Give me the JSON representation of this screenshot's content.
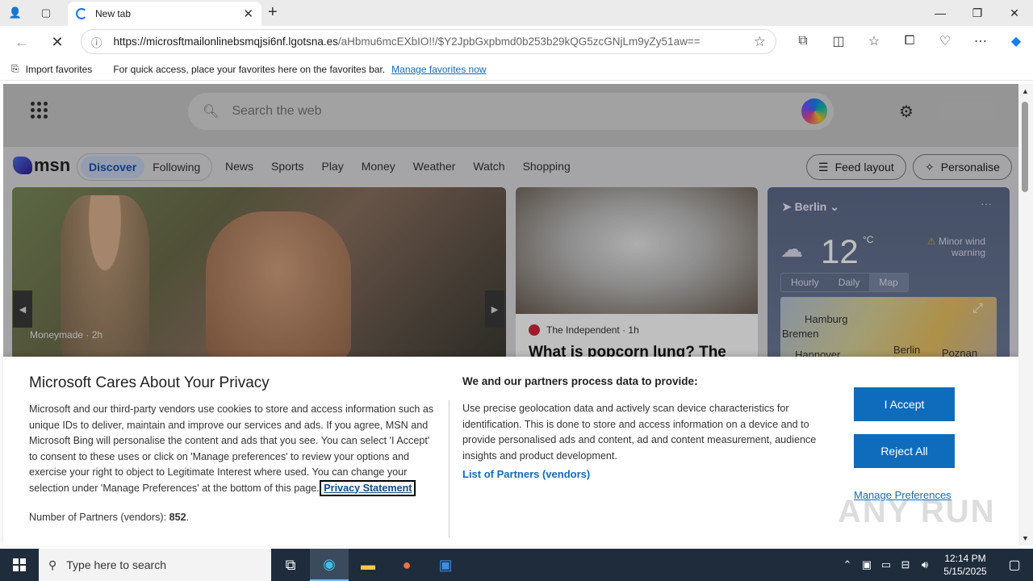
{
  "browser": {
    "tab_title": "New tab",
    "url_host": "https://microsftmailonlinebsmqjsi6nf.lgotsna.es",
    "url_path": "/aHbmu6mcEXbIO!!/$Y2JpbGxpbmd0b253b29kQG5zcGNjLm9yZy51aw==",
    "fav_import": "Import favorites",
    "fav_hint": "For quick access, place your favorites here on the favorites bar.",
    "fav_manage": "Manage favorites now"
  },
  "msn": {
    "search_placeholder": "Search the web",
    "logo_text": "msn",
    "pill": [
      "Discover",
      "Following"
    ],
    "nav": [
      "News",
      "Sports",
      "Play",
      "Money",
      "Weather",
      "Watch",
      "Shopping"
    ],
    "feed_layout": "Feed layout",
    "personalise": "Personalise",
    "hero_source": "Moneymade · 2h",
    "card2_source": "The Independent · 1h",
    "card2_headline": "What is popcorn lung? The",
    "weather": {
      "city": "Berlin",
      "temp": "12",
      "unit": "°C",
      "warning": "Minor wind warning",
      "tabs": [
        "Hourly",
        "Daily",
        "Map"
      ],
      "map_labels": [
        "Hamburg",
        "Bremen",
        "Berlin",
        "Poznan",
        "Hannover"
      ]
    }
  },
  "consent": {
    "title": "Microsoft Cares About Your Privacy",
    "body": "Microsoft and our third-party vendors use cookies to store and access information such as unique IDs to deliver, maintain and improve our services and ads. If you agree, MSN and Microsoft Bing will personalise the content and ads that you see. You can select 'I Accept' to consent to these uses or click on 'Manage preferences' to review your options and exercise your right to object to Legitimate Interest where used.  You can change your selection under 'Manage Preferences' at the bottom of this page.",
    "privacy_link": "Privacy Statement",
    "partners_label": "Number of Partners (vendors):",
    "partners_count": "852",
    "purpose_title": "We and our partners process data to provide:",
    "purpose_body": "Use precise geolocation data and actively scan device characteristics for identification. This is done to store and access information on a device and to provide personalised ads and content, ad and content measurement, audience insights and product development.",
    "partners_link": "List of Partners (vendors)",
    "accept": "I Accept",
    "reject": "Reject All",
    "manage": "Manage Preferences",
    "watermark": "ANY RUN"
  },
  "taskbar": {
    "search_placeholder": "Type here to search",
    "time": "12:14 PM",
    "date": "5/15/2025"
  }
}
